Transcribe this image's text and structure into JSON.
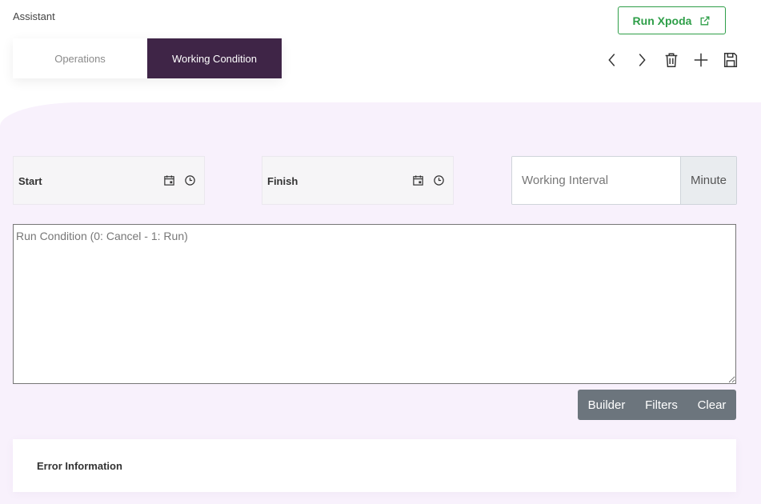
{
  "header": {
    "assistant_label": "Assistant",
    "run_button_label": "Run Xpoda"
  },
  "tabs": [
    {
      "label": "Operations",
      "active": false
    },
    {
      "label": "Working Condition",
      "active": true
    }
  ],
  "toolbar": {
    "icons": [
      "chevron-left-icon",
      "chevron-right-icon",
      "trash-icon",
      "plus-icon",
      "save-icon"
    ]
  },
  "fields": {
    "start_label": "Start",
    "finish_label": "Finish",
    "interval_placeholder": "Working Interval",
    "interval_value": "",
    "interval_unit": "Minute",
    "condition_placeholder": "Run Condition (0: Cancel - 1: Run)",
    "condition_value": ""
  },
  "condition_buttons": {
    "builder": "Builder",
    "filters": "Filters",
    "clear": "Clear"
  },
  "error_panel": {
    "title": "Error Information"
  },
  "colors": {
    "accent": "#3f2547",
    "success": "#2e9e48",
    "background_tint": "#f8f1fc",
    "secondary": "#6c757d"
  }
}
